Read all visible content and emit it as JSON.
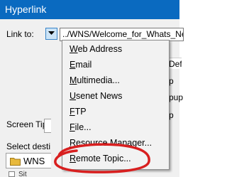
{
  "window": {
    "title": "Hyperlink"
  },
  "form": {
    "link_to_label": "Link to:",
    "url_value": "../WNS/Welcome_for_Whats_New",
    "screen_tip_label": "Screen Tip",
    "select_destination_label": "Select desti",
    "background_fragments": {
      "defa": "Defa",
      "p1": "p",
      "p2": "pup",
      "p3": "p"
    }
  },
  "tree": {
    "folder_label": "WNS",
    "next_row_text": "Sit",
    "folder_icon_color": "#e8b93c"
  },
  "link_menu": {
    "items": [
      {
        "label": "Web Address"
      },
      {
        "label": "Email"
      },
      {
        "label": "Multimedia..."
      },
      {
        "label": "Usenet News"
      },
      {
        "label": "FTP"
      },
      {
        "label": "File..."
      },
      {
        "label": "Resource Manager..."
      },
      {
        "label": "Remote Topic..."
      }
    ]
  },
  "colors": {
    "title_bar": "#0a6ac0",
    "dropdown_button_bg": "#cce4f7",
    "annotation_circle": "#d81f1f"
  },
  "icons": {
    "dropdown": "chevron-down-icon",
    "folder": "folder-icon"
  }
}
